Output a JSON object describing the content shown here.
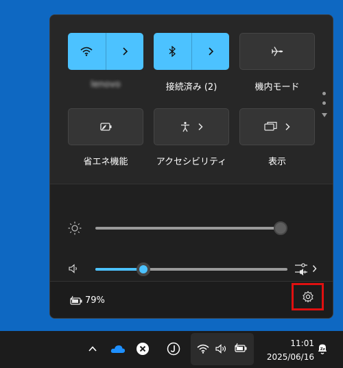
{
  "tiles": {
    "wifi": {
      "label": "lenovo",
      "state": "on",
      "icon": "wifi-icon"
    },
    "bluetooth": {
      "label": "接続済み (2)",
      "state": "on",
      "icon": "bluetooth-icon"
    },
    "airplane": {
      "label": "機内モード",
      "state": "off",
      "icon": "airplane-icon"
    },
    "energy_saver": {
      "label": "省エネ機能",
      "state": "off",
      "icon": "battery-saver-icon"
    },
    "accessibility": {
      "label": "アクセシビリティ",
      "state": "off",
      "icon": "accessibility-icon"
    },
    "display": {
      "label": "表示",
      "state": "off",
      "icon": "display-icon"
    }
  },
  "sliders": {
    "brightness": {
      "value_percent": 100,
      "icon": "brightness-icon"
    },
    "volume": {
      "value_percent": 25,
      "icon": "speaker-icon"
    }
  },
  "footer": {
    "battery_text": "79%"
  },
  "taskbar": {
    "time": "11:01",
    "date": "2025/06/16"
  },
  "colors": {
    "accent": "#4cc2ff",
    "desktop": "#0e68c2",
    "highlight": "#e01010"
  }
}
